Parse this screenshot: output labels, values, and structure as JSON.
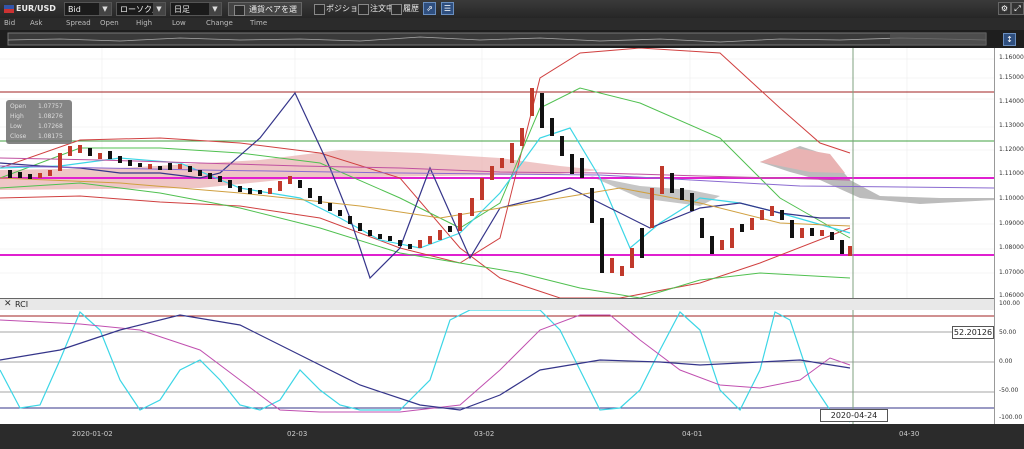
{
  "toolbar": {
    "pair_label": "EUR/USD",
    "price_type": "Bid",
    "chart_type": "ローソク足",
    "period": "日足",
    "select_pair_label": "通貨ペアを選択",
    "position_label": "ポジション",
    "orders_label": "注文中",
    "history_label": "履歴"
  },
  "legend": {
    "bid": "Bid",
    "ask": "Ask",
    "spread": "Spread",
    "open": "Open",
    "high": "High",
    "low": "Low",
    "change": "Change",
    "time": "Time"
  },
  "ohlc": {
    "open_label": "Open",
    "open": "1.07757",
    "high_label": "High",
    "high": "1.08276",
    "low_label": "Low",
    "low": "1.07268",
    "close_label": "Close",
    "close": "1.08175"
  },
  "price_axis": [
    "1.16000",
    "1.15000",
    "1.14000",
    "1.13000",
    "1.12000",
    "1.11000",
    "1.10000",
    "1.09000",
    "1.08000",
    "1.07000",
    "1.06000"
  ],
  "rci": {
    "title": "RCI",
    "axis": [
      "100.00",
      "50.00",
      "0.00",
      "-50.00",
      "-100.00"
    ],
    "current_value": "52.20126"
  },
  "time_axis": {
    "labels": [
      "2020-01-02",
      "02-03",
      "03-02",
      "04-01",
      "04-30"
    ],
    "cursor_date": "2020-04-24"
  },
  "colors": {
    "bull": "#c0392b",
    "bear": "#111111",
    "ichimoku_cloud": "#e9b3b3",
    "ichimoku_cloud_bear": "#b8b8b8",
    "magenta_line": "#e020d0",
    "cyan_line": "#3cd6e6",
    "navy_line": "#35358a"
  }
}
